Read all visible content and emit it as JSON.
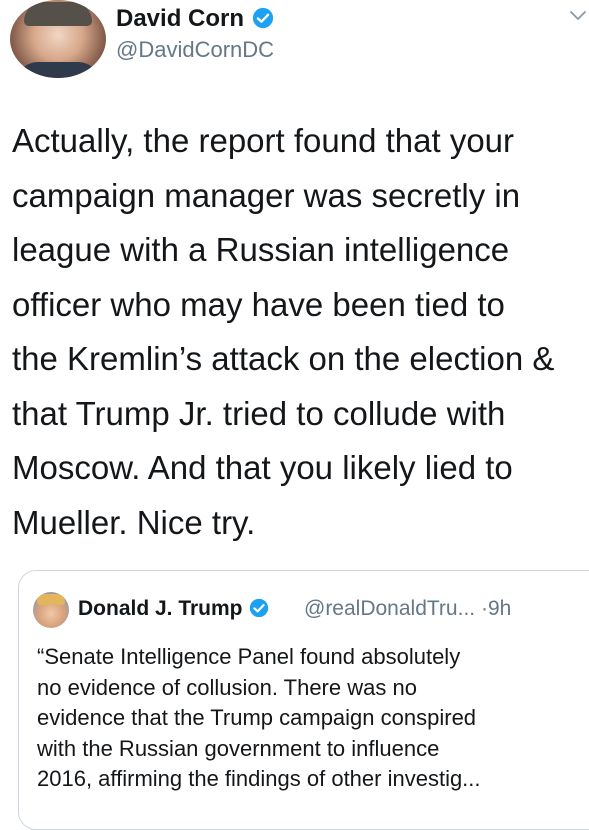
{
  "tweet": {
    "author": {
      "display_name": "David Corn",
      "handle": "@DavidCornDC"
    },
    "text_lines": [
      "Actually, the report found that your",
      "campaign manager was secretly in",
      "league with a Russian intelligence",
      "officer who may have been tied to",
      "the Kremlin’s attack on the election &",
      "that Trump Jr. tried to collude with",
      "Moscow. And that you likely lied to",
      "Mueller. Nice try."
    ]
  },
  "quoted_tweet": {
    "author": {
      "display_name": "Donald J. Trump",
      "handle": "@realDonaldTru..."
    },
    "separator": "·",
    "time": "9h",
    "text_lines": [
      "“Senate Intelligence Panel found absolutely",
      "no evidence of collusion. There was no",
      "evidence that the Trump campaign conspired",
      "with the Russian government to influence",
      "2016, affirming the findings of other investig..."
    ]
  },
  "colors": {
    "verified_badge": "#1da1f2",
    "secondary_text": "#657786",
    "card_border": "#ccd6dd"
  },
  "icons": {
    "verified": "verified-badge-icon",
    "more": "chevron-down-icon"
  }
}
